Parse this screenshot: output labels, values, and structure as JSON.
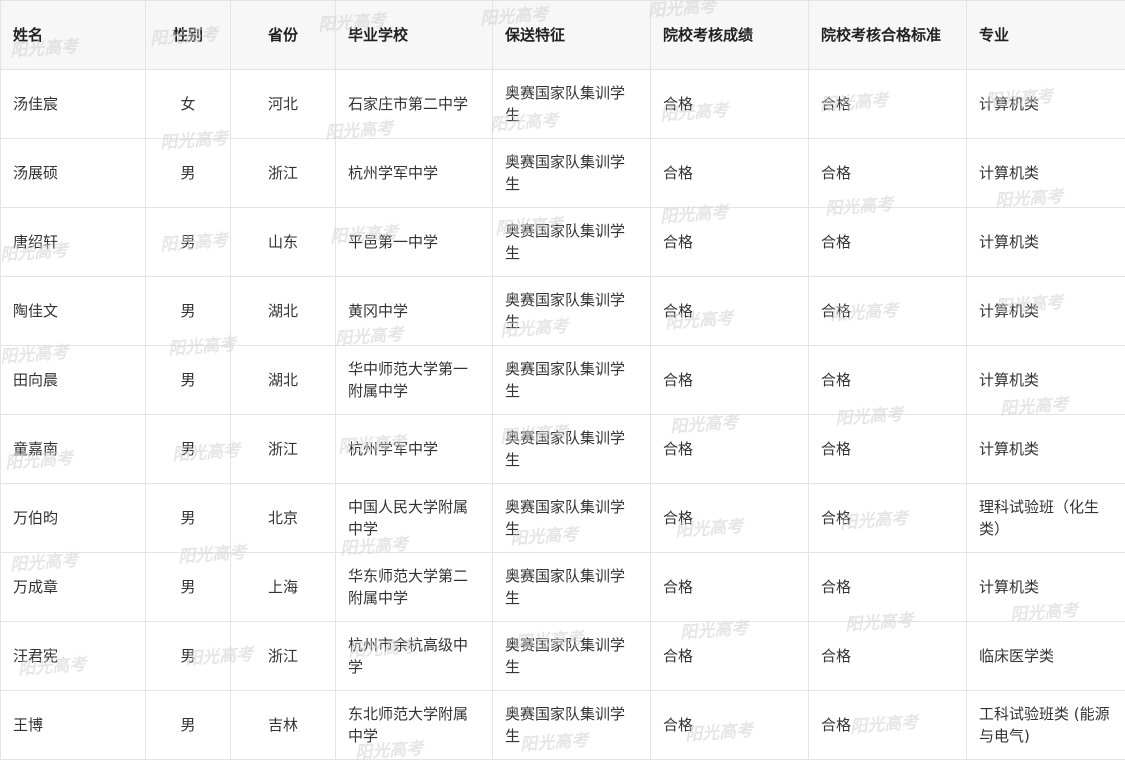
{
  "table": {
    "headers": [
      "姓名",
      "性别",
      "省份",
      "毕业学校",
      "保送特征",
      "院校考核成绩",
      "院校考核合格标准",
      "专业"
    ],
    "rows": [
      [
        "汤佳宸",
        "女",
        "河北",
        "石家庄市第二中学",
        "奥赛国家队集训学生",
        "合格",
        "合格",
        "计算机类"
      ],
      [
        "汤展硕",
        "男",
        "浙江",
        "杭州学军中学",
        "奥赛国家队集训学生",
        "合格",
        "合格",
        "计算机类"
      ],
      [
        "唐绍轩",
        "男",
        "山东",
        "平邑第一中学",
        "奥赛国家队集训学生",
        "合格",
        "合格",
        "计算机类"
      ],
      [
        "陶佳文",
        "男",
        "湖北",
        "黄冈中学",
        "奥赛国家队集训学生",
        "合格",
        "合格",
        "计算机类"
      ],
      [
        "田向晨",
        "男",
        "湖北",
        "华中师范大学第一附属中学",
        "奥赛国家队集训学生",
        "合格",
        "合格",
        "计算机类"
      ],
      [
        "童嘉南",
        "男",
        "浙江",
        "杭州学军中学",
        "奥赛国家队集训学生",
        "合格",
        "合格",
        "计算机类"
      ],
      [
        "万伯昀",
        "男",
        "北京",
        "中国人民大学附属中学",
        "奥赛国家队集训学生",
        "合格",
        "合格",
        "理科试验班（化生类）"
      ],
      [
        "万成章",
        "男",
        "上海",
        "华东师范大学第二附属中学",
        "奥赛国家队集训学生",
        "合格",
        "合格",
        "计算机类"
      ],
      [
        "汪君宪",
        "男",
        "浙江",
        "杭州市余杭高级中学",
        "奥赛国家队集训学生",
        "合格",
        "合格",
        "临床医学类"
      ],
      [
        "王博",
        "男",
        "吉林",
        "东北师范大学附属中学",
        "奥赛国家队集训学生",
        "合格",
        "合格",
        "工科试验班类 (能源与电气)"
      ]
    ]
  },
  "watermark": {
    "text": "阳光高考",
    "color": "#d2d2d2"
  }
}
